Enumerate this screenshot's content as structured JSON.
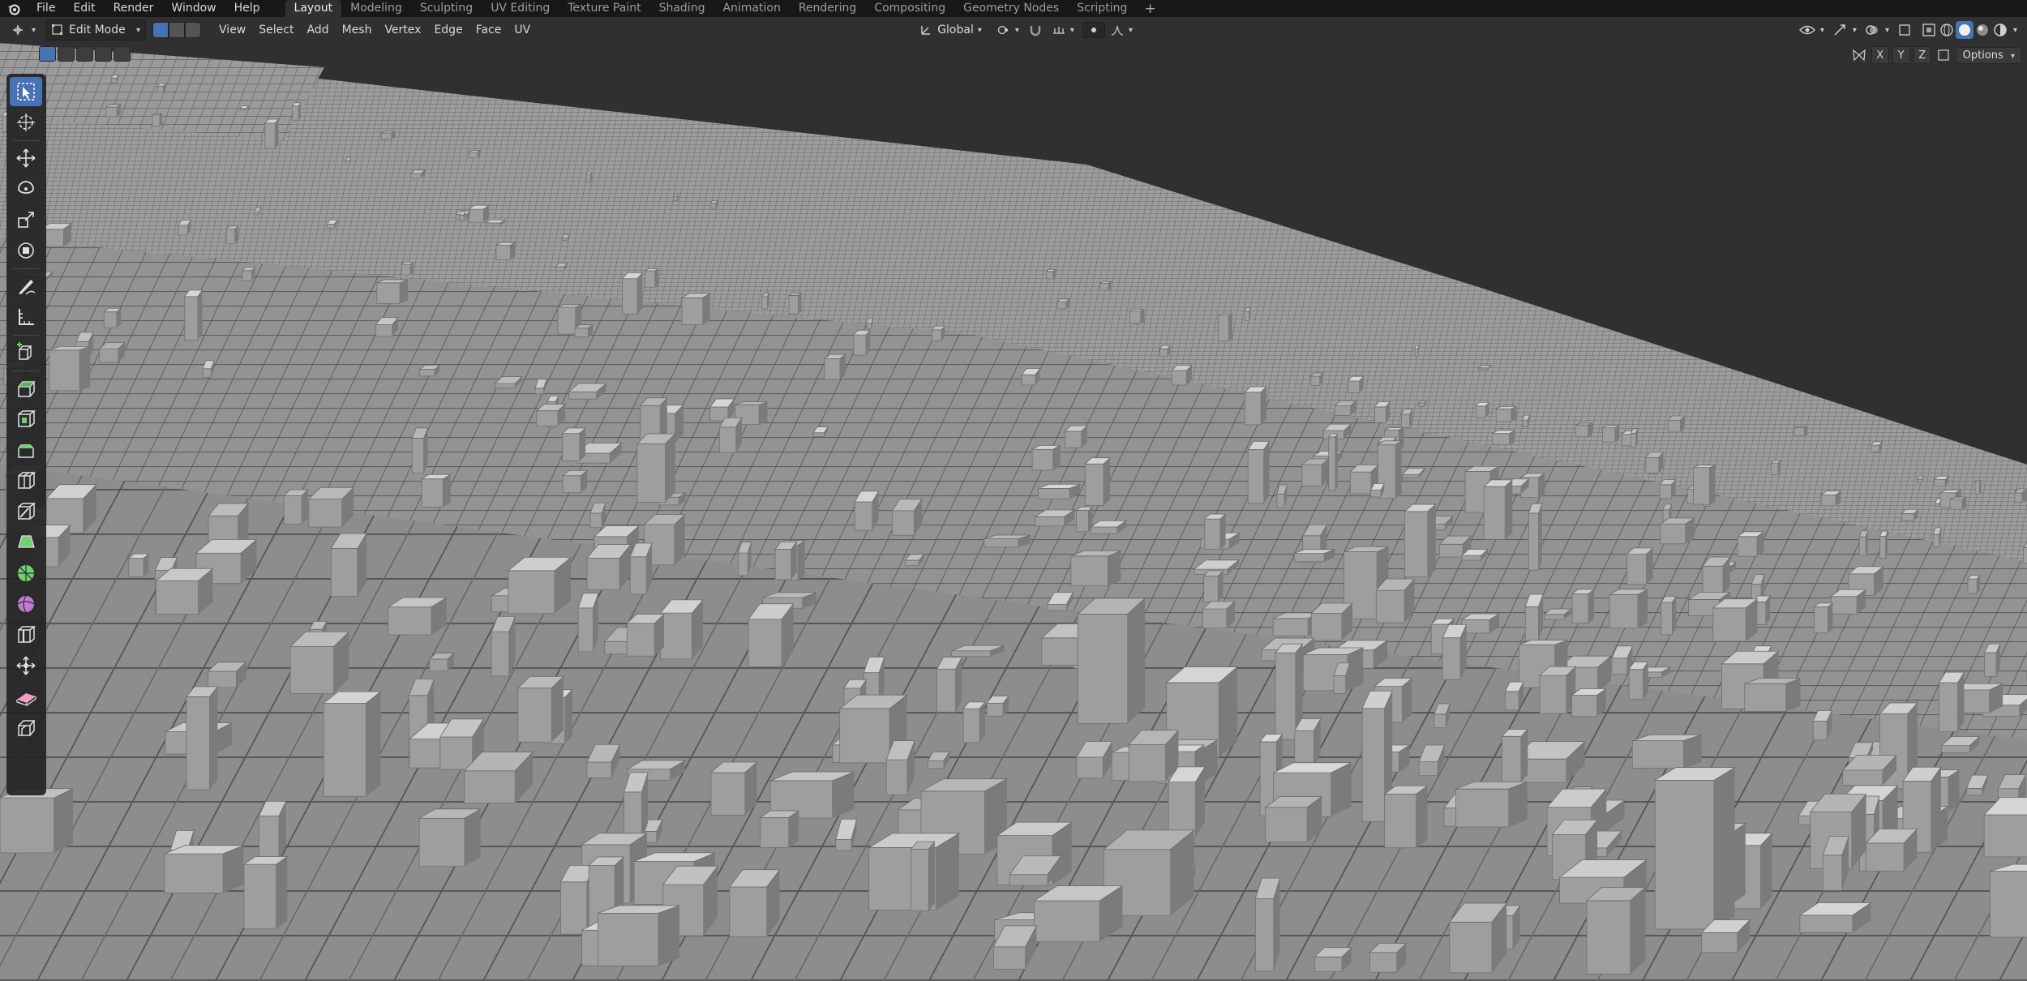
{
  "topbar": {
    "menus": [
      "File",
      "Edit",
      "Render",
      "Window",
      "Help"
    ],
    "workspaces": [
      "Layout",
      "Modeling",
      "Sculpting",
      "UV Editing",
      "Texture Paint",
      "Shading",
      "Animation",
      "Rendering",
      "Compositing",
      "Geometry Nodes",
      "Scripting"
    ],
    "active_workspace": "Layout",
    "add_tab": "+"
  },
  "header": {
    "mode": "Edit Mode",
    "menus": [
      "View",
      "Select",
      "Add",
      "Mesh",
      "Vertex",
      "Edge",
      "Face",
      "UV"
    ],
    "transform_orientation": "Global"
  },
  "viewport": {
    "axes": [
      "X",
      "Y",
      "Z"
    ],
    "options_label": "Options"
  },
  "toolbar": {
    "tools": [
      "select-box",
      "cursor",
      "move",
      "rotate",
      "scale",
      "transform",
      "annotate",
      "measure",
      "add-cube",
      "extrude-region",
      "inset-faces",
      "bevel",
      "loop-cut",
      "knife",
      "poly-build",
      "spin",
      "smooth",
      "edge-slide",
      "shrink-fatten",
      "shear",
      "rip-region"
    ],
    "active_tool": "select-box"
  },
  "colors": {
    "accent": "#4772b3",
    "background": "#303030",
    "topbar": "#181818",
    "mesh_light": "#a9a9a9",
    "mesh_dark": "#6f6f6f"
  }
}
